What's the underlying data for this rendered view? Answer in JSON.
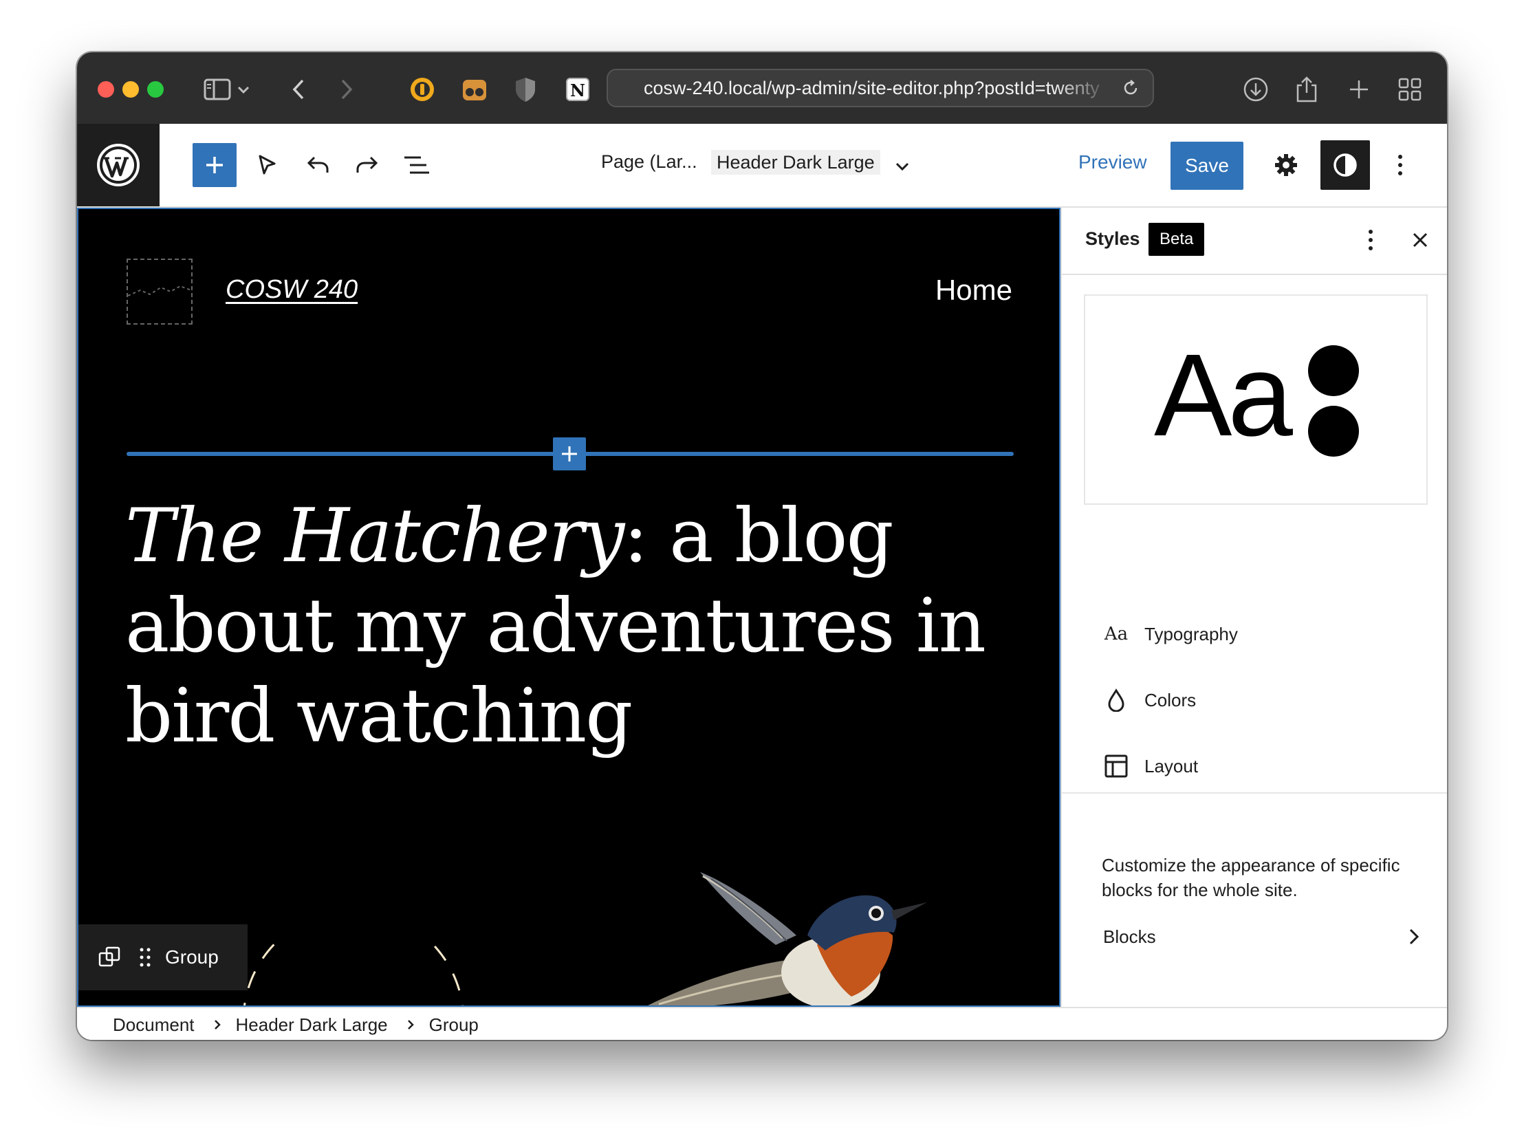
{
  "browser": {
    "url": "cosw-240.local/wp-admin/site-editor.php?postId=twenty",
    "colors": {
      "close": "#ff5f57",
      "minimize": "#febc2e",
      "zoom": "#28c840"
    }
  },
  "toolbar": {
    "doc_title": "Page (Lar...",
    "template_name": "Header Dark Large",
    "preview_label": "Preview",
    "save_label": "Save",
    "accent": "#3173b8"
  },
  "canvas": {
    "site_title": "COSW 240",
    "nav_home": "Home",
    "headline_italic": "The Hatchery",
    "headline_rest": ": a blog about my adventures in bird watching",
    "block_toolbar_label": "Group"
  },
  "styles_panel": {
    "title": "Styles",
    "badge": "Beta",
    "preview_text": "Aa",
    "menu": [
      {
        "icon": "typography-icon",
        "glyph": "Aa",
        "label": "Typography"
      },
      {
        "icon": "droplet-icon",
        "label": "Colors"
      },
      {
        "icon": "layout-icon",
        "label": "Layout"
      }
    ],
    "description": "Customize the appearance of specific blocks for the whole site.",
    "blocks_label": "Blocks"
  },
  "breadcrumb": [
    "Document",
    "Header Dark Large",
    "Group"
  ]
}
